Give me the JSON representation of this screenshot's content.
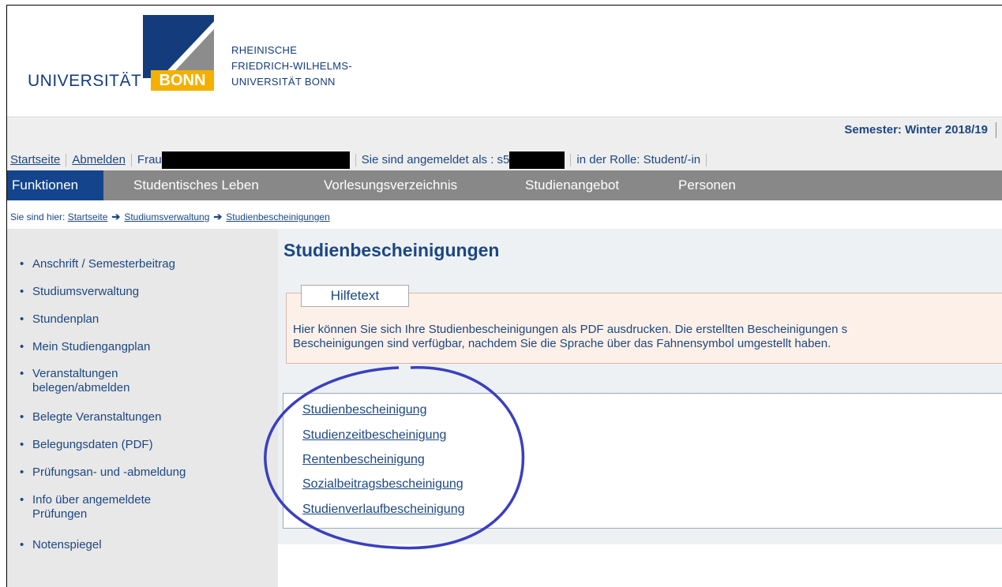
{
  "logo": {
    "university": "UNIVERSITÄT",
    "bonn": "BONN",
    "lines": [
      "RHEINISCHE",
      "FRIEDRICH-WILHELMS-",
      "UNIVERSITÄT BONN"
    ],
    "colors": {
      "blue": "#143c7c",
      "yellow": "#f4b000",
      "gray": "#8c8c8c"
    }
  },
  "userbar": {
    "semester": "Semester: Winter 2018/19",
    "startseite": "Startseite",
    "abmelden": "Abmelden",
    "anrede": "Frau",
    "angemeldet": "Sie sind angemeldet als : s5",
    "rolle": "in der Rolle: Student/-in"
  },
  "nav": {
    "tabs": [
      "Funktionen",
      "Studentisches Leben",
      "Vorlesungsverzeichnis",
      "Studienangebot",
      "Personen"
    ]
  },
  "breadcrumb": {
    "prefix": "Sie sind hier:",
    "items": [
      "Startseite",
      "Studiumsverwaltung",
      "Studienbescheinigungen"
    ]
  },
  "sidebar": {
    "items": [
      "Anschrift / Semesterbeitrag",
      "Studiumsverwaltung",
      "Stundenplan",
      "Mein Studiengangplan",
      "Veranstaltungen belegen/abmelden",
      "Belegte Veranstaltungen",
      "Belegungsdaten (PDF)",
      "Prüfungsan- und -abmeldung",
      "Info über angemeldete Prüfungen",
      "Notenspiegel"
    ]
  },
  "main": {
    "title": "Studienbescheinigungen",
    "help_legend": "Hilfetext",
    "help_line1": "Hier können Sie sich Ihre Studienbescheinigungen als PDF ausdrucken. Die erstellten Bescheinigungen s",
    "help_line2": "Bescheinigungen sind verfügbar, nachdem Sie die Sprache über das Fahnensymbol umgestellt haben.",
    "links": [
      "Studienbescheinigung",
      "Studienzeitbescheinigung",
      "Rentenbescheinigung",
      "Sozialbeitragsbescheinigung",
      "Studienverlaufbescheinigung"
    ]
  },
  "annotation": {
    "color": "#3a3fc0"
  }
}
